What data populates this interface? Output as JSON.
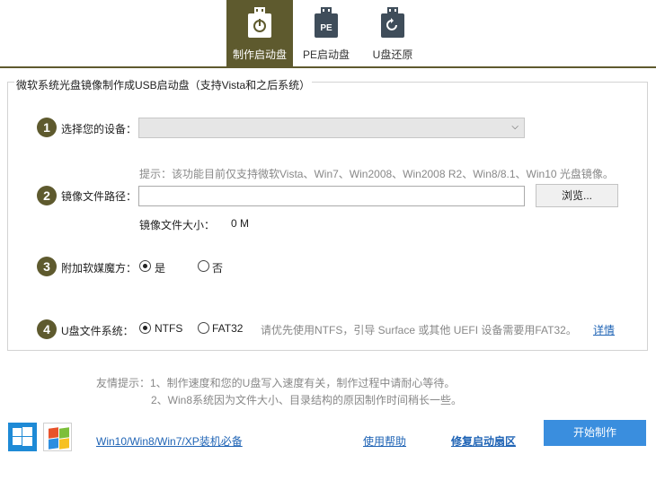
{
  "tabs": [
    {
      "label": "制作启动盘",
      "icon": "usb-power-icon",
      "active": true
    },
    {
      "label": "PE启动盘",
      "icon": "usb-pe-icon",
      "badge": "PE",
      "active": false
    },
    {
      "label": "U盘还原",
      "icon": "usb-restore-icon",
      "active": false
    }
  ],
  "group_title": "微软系统光盘镜像制作成USB启动盘（支持Vista和之后系统）",
  "step1": {
    "num": "1",
    "label": "选择您的设备："
  },
  "step2": {
    "num": "2",
    "label": "镜像文件路径：",
    "hint": "提示：该功能目前仅支持微软Vista、Win7、Win2008、Win2008 R2、Win8/8.1、Win10 光盘镜像。",
    "browse": "浏览...",
    "size_label": "镜像文件大小：",
    "size_value": "0 M"
  },
  "step3": {
    "num": "3",
    "label": "附加软媒魔方：",
    "yes": "是",
    "no": "否"
  },
  "step4": {
    "num": "4",
    "label": "U盘文件系统：",
    "ntfs": "NTFS",
    "fat32": "FAT32",
    "note": "请优先使用NTFS，引导 Surface 或其他 UEFI 设备需要用FAT32。",
    "detail": "详情"
  },
  "tips": {
    "line1": "友情提示：1、制作速度和您的U盘写入速度有关，制作过程中请耐心等待。",
    "line2": "2、Win8系统因为文件大小、目录结构的原因制作时间稍长一些。"
  },
  "footer": {
    "link_main": "Win10/Win8/Win7/XP装机必备",
    "help": "使用帮助",
    "repair": "修复启动扇区",
    "start": "开始制作"
  },
  "colors": {
    "accent": "#5e5a2e",
    "button": "#3a8ede",
    "link": "#1e63b5"
  }
}
